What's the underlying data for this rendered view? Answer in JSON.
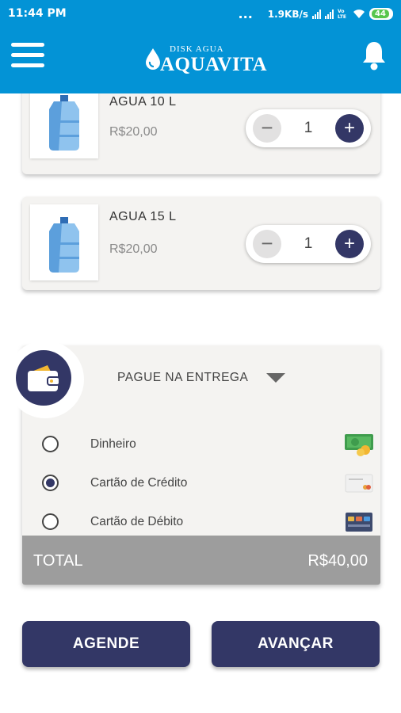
{
  "status_bar": {
    "time": "11:44 PM",
    "dots": "...",
    "speed": "1.9KB/s",
    "net_label": "Vo LTE",
    "battery": "44"
  },
  "header": {
    "logo_small": "DISK AGUA",
    "logo_brand": "AQUAVITA",
    "icons": [
      "menu-icon",
      "bell-icon"
    ]
  },
  "products": [
    {
      "name": "AGUA 10 L",
      "price": "R$20,00",
      "quantity": "1"
    },
    {
      "name": "AGUA 15 L",
      "price": "R$20,00",
      "quantity": "1"
    }
  ],
  "stepper": {
    "minus": "−",
    "plus": "+"
  },
  "payment": {
    "title": "PAGUE NA ENTREGA",
    "options": [
      {
        "label": "Dinheiro",
        "selected": false,
        "icon": "cash-icon"
      },
      {
        "label": "Cartão de Crédito",
        "selected": true,
        "icon": "credit-card-icon"
      },
      {
        "label": "Cartão de Débito",
        "selected": false,
        "icon": "debit-card-icon"
      }
    ],
    "total_label": "TOTAL",
    "total_value": "R$40,00"
  },
  "buttons": {
    "schedule": "AGENDE",
    "next": "AVANÇAR"
  },
  "colors": {
    "primary_blue": "#0393d6",
    "navy": "#333766",
    "card_bg": "#f4f3f1",
    "total_bar": "#9d9d9d"
  }
}
